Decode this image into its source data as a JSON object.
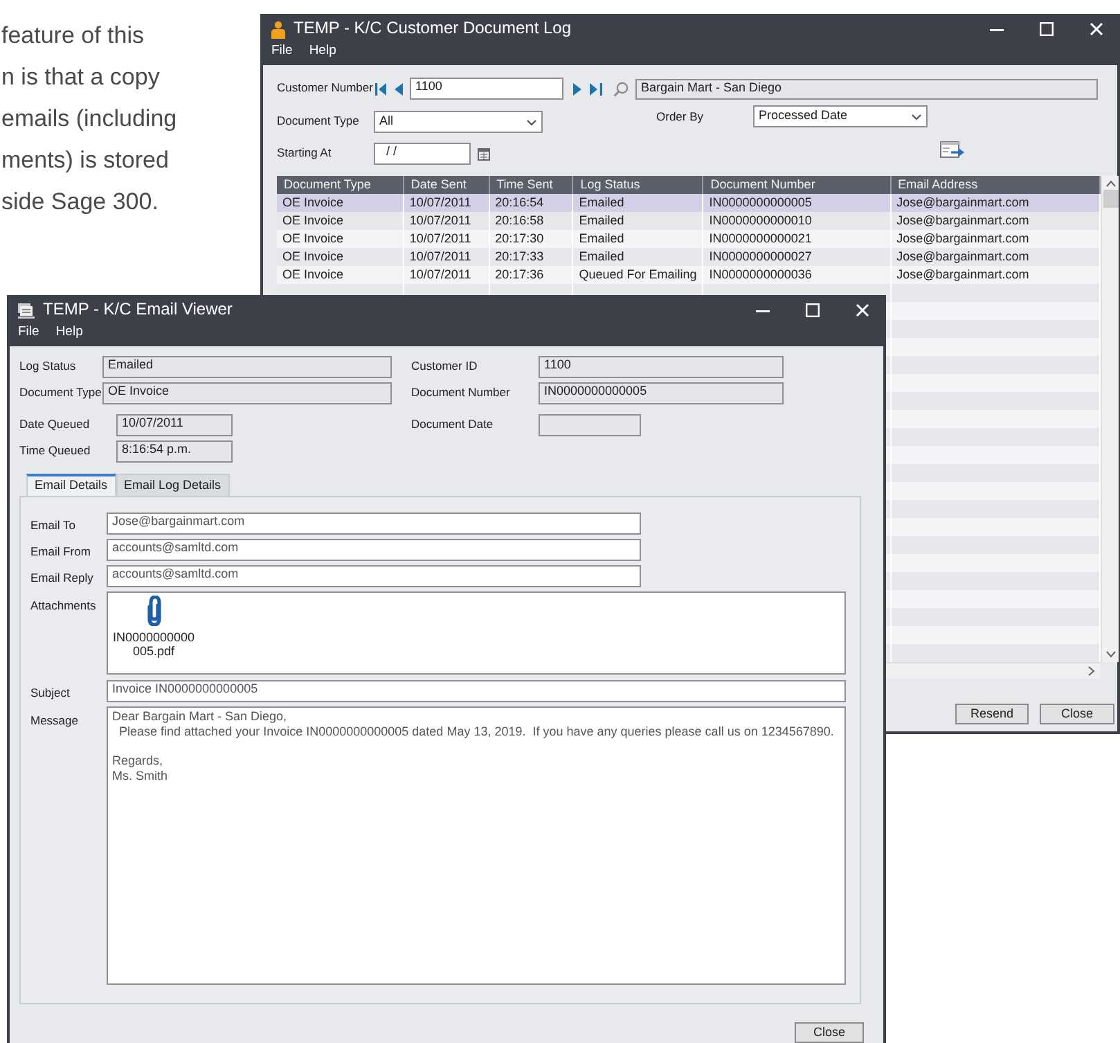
{
  "intro_text": [
    "feature of this",
    "n is that a copy",
    "emails (including",
    "ments) is stored",
    "side Sage 300."
  ],
  "log_window": {
    "title": "TEMP - K/C Customer Document Log",
    "menu": [
      "File",
      "Help"
    ],
    "customer_number": {
      "label": "Customer Number",
      "value": "1100"
    },
    "customer_name": "Bargain Mart - San Diego",
    "document_type": {
      "label": "Document Type",
      "value": "All"
    },
    "order_by": {
      "label": "Order By",
      "value": "Processed Date"
    },
    "starting_at": {
      "label": "Starting At",
      "value": "/ /"
    },
    "table": {
      "columns": [
        "Document Type",
        "Date Sent",
        "Time Sent",
        "Log Status",
        "Document Number",
        "Email Address"
      ],
      "rows": [
        {
          "selected": true,
          "cells": [
            "OE Invoice",
            "10/07/2011",
            "20:16:54",
            "Emailed",
            "IN0000000000005",
            "Jose@bargainmart.com"
          ]
        },
        {
          "selected": false,
          "cells": [
            "OE Invoice",
            "10/07/2011",
            "20:16:58",
            "Emailed",
            "IN0000000000010",
            "Jose@bargainmart.com"
          ]
        },
        {
          "selected": false,
          "cells": [
            "OE Invoice",
            "10/07/2011",
            "20:17:30",
            "Emailed",
            "IN0000000000021",
            "Jose@bargainmart.com"
          ]
        },
        {
          "selected": false,
          "cells": [
            "OE Invoice",
            "10/07/2011",
            "20:17:33",
            "Emailed",
            "IN0000000000027",
            "Jose@bargainmart.com"
          ]
        },
        {
          "selected": false,
          "cells": [
            "OE Invoice",
            "10/07/2011",
            "20:17:36",
            "Queued For Emailing",
            "IN0000000000036",
            "Jose@bargainmart.com"
          ]
        }
      ]
    },
    "buttons": [
      "Resend",
      "Close"
    ]
  },
  "viewer_window": {
    "title": "TEMP - K/C Email Viewer",
    "menu": [
      "File",
      "Help"
    ],
    "left_fields": [
      {
        "label": "Log Status",
        "value": "Emailed"
      },
      {
        "label": "Document Type",
        "value": "OE Invoice"
      },
      {
        "label": "Date Queued",
        "value": "10/07/2011"
      },
      {
        "label": "Time Queued",
        "value": "8:16:54 p.m."
      }
    ],
    "right_fields": [
      {
        "label": "Customer ID",
        "value": "1100"
      },
      {
        "label": "Document Number",
        "value": "IN0000000000005"
      },
      {
        "label": "Document Date"
      }
    ],
    "tabs": [
      {
        "label": "Email Details",
        "selected": true
      },
      {
        "label": "Email Log Details",
        "selected": false
      }
    ],
    "email_fields": [
      {
        "label": "Email To",
        "value": "Jose@bargainmart.com"
      },
      {
        "label": "Email From",
        "value": "accounts@samltd.com"
      },
      {
        "label": "Email Reply",
        "value": "accounts@samltd.com"
      }
    ],
    "attachments": {
      "label": "Attachments",
      "files": [
        {
          "name": "IN0000000000005.pdf"
        }
      ]
    },
    "subject": {
      "label": "Subject",
      "value": "Invoice IN0000000000005"
    },
    "message": {
      "label": "Message",
      "text": "Dear Bargain Mart - San Diego,\n  Please find attached your Invoice IN0000000000005 dated May 13, 2019.  If you have any queries please call us on 1234567890.\n\nRegards,\nMs. Smith"
    },
    "buttons": [
      "Close"
    ]
  }
}
